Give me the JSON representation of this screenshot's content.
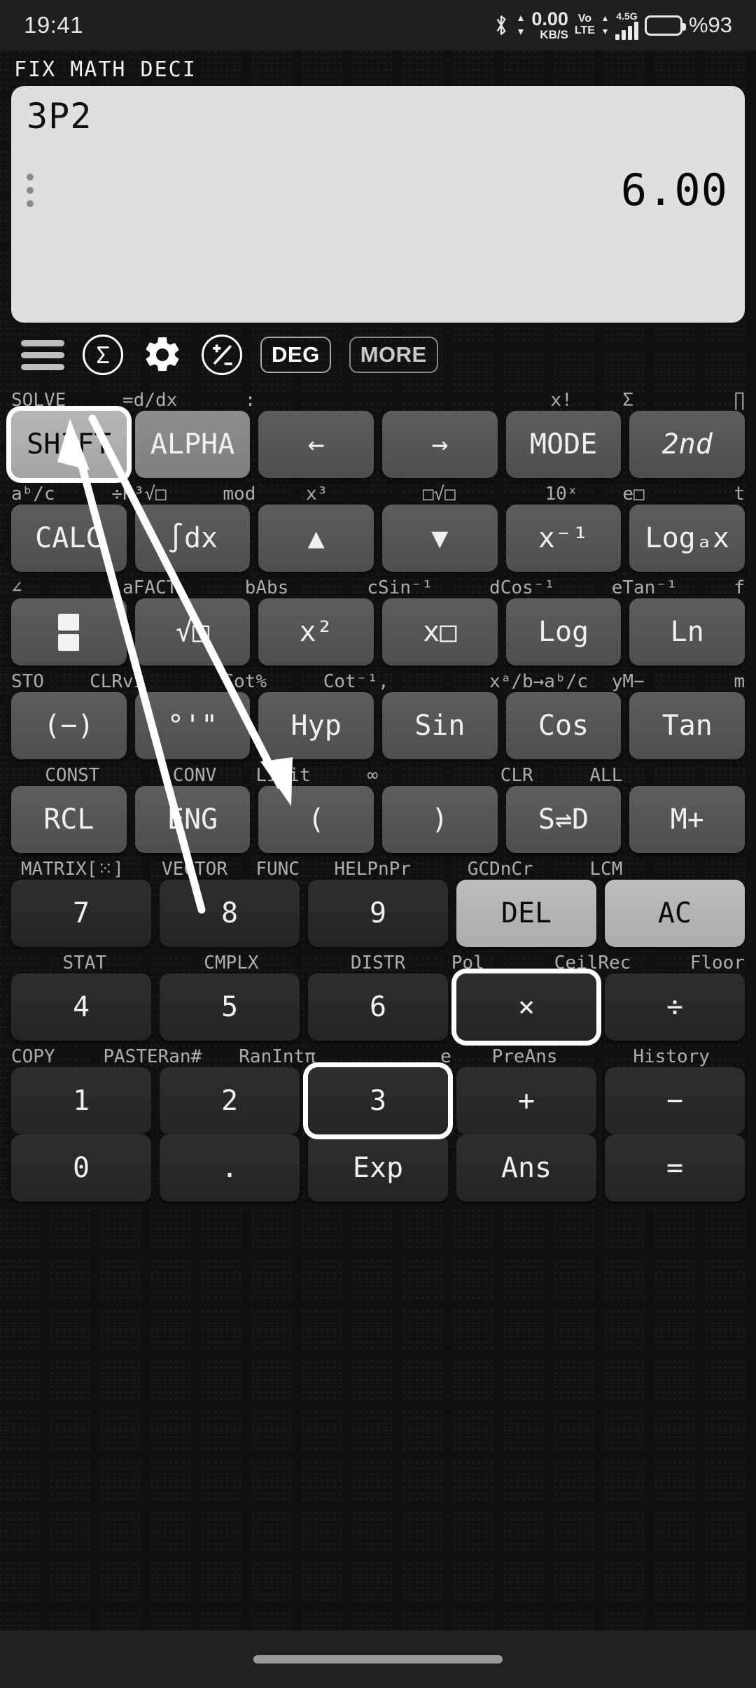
{
  "statusbar": {
    "time": "19:41",
    "bluetooth_icon": "bluetooth-icon",
    "net_rate": "0.00",
    "net_unit": "KB/S",
    "volte_top": "Vo",
    "volte_bottom": "LTE",
    "network_gen": "4.5G",
    "signal_icon": "signal-bars-icon",
    "battery_icon": "battery-icon",
    "battery_percent": "%93"
  },
  "mode_indicators": "FIX MATH DECI",
  "display": {
    "expression": "3P2",
    "result": "6.00",
    "menu_icon": "kebab-menu-icon"
  },
  "toolbar": {
    "menu_icon": "hamburger-menu-icon",
    "sigma_icon": "Σ",
    "gear_icon": "gear-icon",
    "plusminus_icon": "plus-minus-icon",
    "deg_label": "DEG",
    "more_label": "MORE"
  },
  "keypad": {
    "rows": [
      {
        "labels": [
          {
            "left": "SOLVE",
            "right": "="
          },
          {
            "left": "d/dx",
            "right": ":"
          },
          {
            "center": ""
          },
          {
            "center": ""
          },
          {
            "center": "x!"
          },
          {
            "left": "Σ",
            "right": "∏"
          }
        ],
        "keys": [
          {
            "label": "SHIFT",
            "style": "k-shift",
            "selected": true
          },
          {
            "label": "ALPHA",
            "style": "k-alpha"
          },
          {
            "label": "←",
            "style": "k-fn"
          },
          {
            "label": "→",
            "style": "k-fn"
          },
          {
            "label": "MODE",
            "style": "k-fn"
          },
          {
            "label": "2nd",
            "style": "k-fn",
            "italic": true
          }
        ]
      },
      {
        "labels": [
          {
            "left": "aᵇ/c",
            "right": "÷R"
          },
          {
            "left": "³√□",
            "right": "mod"
          },
          {
            "center": "x³"
          },
          {
            "center": "□√□"
          },
          {
            "center": "10ˣ"
          },
          {
            "left": "e□",
            "right": "t"
          }
        ],
        "keys": [
          {
            "label": "CALC",
            "style": "k-fn"
          },
          {
            "label": "∫dx",
            "style": "k-fn"
          },
          {
            "label": "▲",
            "style": "k-fn"
          },
          {
            "label": "▼",
            "style": "k-fn"
          },
          {
            "label": "x⁻¹",
            "style": "k-fn"
          },
          {
            "label": "Logₐx",
            "style": "k-fn"
          }
        ]
      },
      {
        "labels": [
          {
            "left": "∠",
            "right": "a"
          },
          {
            "left": "FACT",
            "right": "b"
          },
          {
            "left": "Abs",
            "right": "c"
          },
          {
            "left": "Sin⁻¹",
            "right": "d"
          },
          {
            "left": "Cos⁻¹",
            "right": "e"
          },
          {
            "left": "Tan⁻¹",
            "right": "f"
          }
        ],
        "keys": [
          {
            "label": "fraction",
            "style": "k-fn",
            "icon": "fraction-icon"
          },
          {
            "label": "√□",
            "style": "k-fn"
          },
          {
            "label": "x²",
            "style": "k-fn"
          },
          {
            "label": "x□",
            "style": "k-fn"
          },
          {
            "label": "Log",
            "style": "k-fn"
          },
          {
            "label": "Ln",
            "style": "k-fn"
          }
        ]
      },
      {
        "labels": [
          {
            "left": "STO",
            "right": "CLRv"
          },
          {
            "left": "i",
            "right": "Cot"
          },
          {
            "left": "%",
            "right": "Cot⁻¹"
          },
          {
            "left": ",",
            "right": "x"
          },
          {
            "left": "ᵃ/b→aᵇ/c",
            "right": "y"
          },
          {
            "left": "M−",
            "right": "m"
          }
        ],
        "keys": [
          {
            "label": "(−)",
            "style": "k-fn"
          },
          {
            "label": "°'\"",
            "style": "k-fn"
          },
          {
            "label": "Hyp",
            "style": "k-fn"
          },
          {
            "label": "Sin",
            "style": "k-fn"
          },
          {
            "label": "Cos",
            "style": "k-fn"
          },
          {
            "label": "Tan",
            "style": "k-fn"
          }
        ]
      },
      {
        "labels": [
          {
            "center": "CONST"
          },
          {
            "center": "CONV"
          },
          {
            "left": "Limit",
            "right": "∞"
          },
          {
            "center": ""
          },
          {
            "left": "CLR",
            "right": "ALL"
          },
          {
            "center": ""
          }
        ],
        "keys": [
          {
            "label": "RCL",
            "style": "k-fn"
          },
          {
            "label": "ENG",
            "style": "k-fn"
          },
          {
            "label": "(",
            "style": "k-fn"
          },
          {
            "label": ")",
            "style": "k-fn"
          },
          {
            "label": "S⇌D",
            "style": "k-fn"
          },
          {
            "label": "M+",
            "style": "k-fn"
          }
        ]
      },
      {
        "labels": [
          {
            "center": "MATRIX[⁙]"
          },
          {
            "center": "VECTOR"
          },
          {
            "left": "FUNC",
            "right": "HELP"
          },
          {
            "left": "nPr",
            "right": "GCD"
          },
          {
            "left": "nCr",
            "right": "LCM"
          },
          {
            "center": ""
          }
        ],
        "keys": [
          {
            "label": "7",
            "style": "k-num"
          },
          {
            "label": "8",
            "style": "k-num"
          },
          {
            "label": "9",
            "style": "k-num"
          },
          {
            "label": "DEL",
            "style": "k-light"
          },
          {
            "label": "AC",
            "style": "k-light"
          }
        ]
      },
      {
        "labels": [
          {
            "center": "STAT"
          },
          {
            "center": "CMPLX"
          },
          {
            "center": "DISTR"
          },
          {
            "left": "Pol",
            "right": "Ceil"
          },
          {
            "left": "Rec",
            "right": "Floor"
          }
        ],
        "keys": [
          {
            "label": "4",
            "style": "k-num"
          },
          {
            "label": "5",
            "style": "k-num"
          },
          {
            "label": "6",
            "style": "k-num"
          },
          {
            "label": "×",
            "style": "k-num",
            "selected": true
          },
          {
            "label": "÷",
            "style": "k-num"
          }
        ]
      },
      {
        "labels": [
          {
            "left": "COPY",
            "right": "PASTE"
          },
          {
            "left": "Ran#",
            "right": "RanInt"
          },
          {
            "left": "π",
            "right": "e"
          },
          {
            "center": "PreAns"
          },
          {
            "center": "History"
          }
        ],
        "keys": [
          {
            "label": "1",
            "style": "k-num"
          },
          {
            "label": "2",
            "style": "k-num"
          },
          {
            "label": "3",
            "style": "k-num",
            "selected": true
          },
          {
            "label": "+",
            "style": "k-num"
          },
          {
            "label": "−",
            "style": "k-num"
          }
        ]
      },
      {
        "labels": [],
        "keys": [
          {
            "label": "0",
            "style": "k-num"
          },
          {
            "label": ".",
            "style": "k-num"
          },
          {
            "label": "Exp",
            "style": "k-num"
          },
          {
            "label": "Ans",
            "style": "k-num"
          },
          {
            "label": "=",
            "style": "k-num"
          }
        ]
      }
    ]
  },
  "annotations": {
    "arrow_1": "arrow-to-shift-key",
    "arrow_2": "arrow-to-multiply-key",
    "highlight_color": "#ffffff"
  },
  "navbar": {
    "gesture_pill": "gesture-pill"
  }
}
